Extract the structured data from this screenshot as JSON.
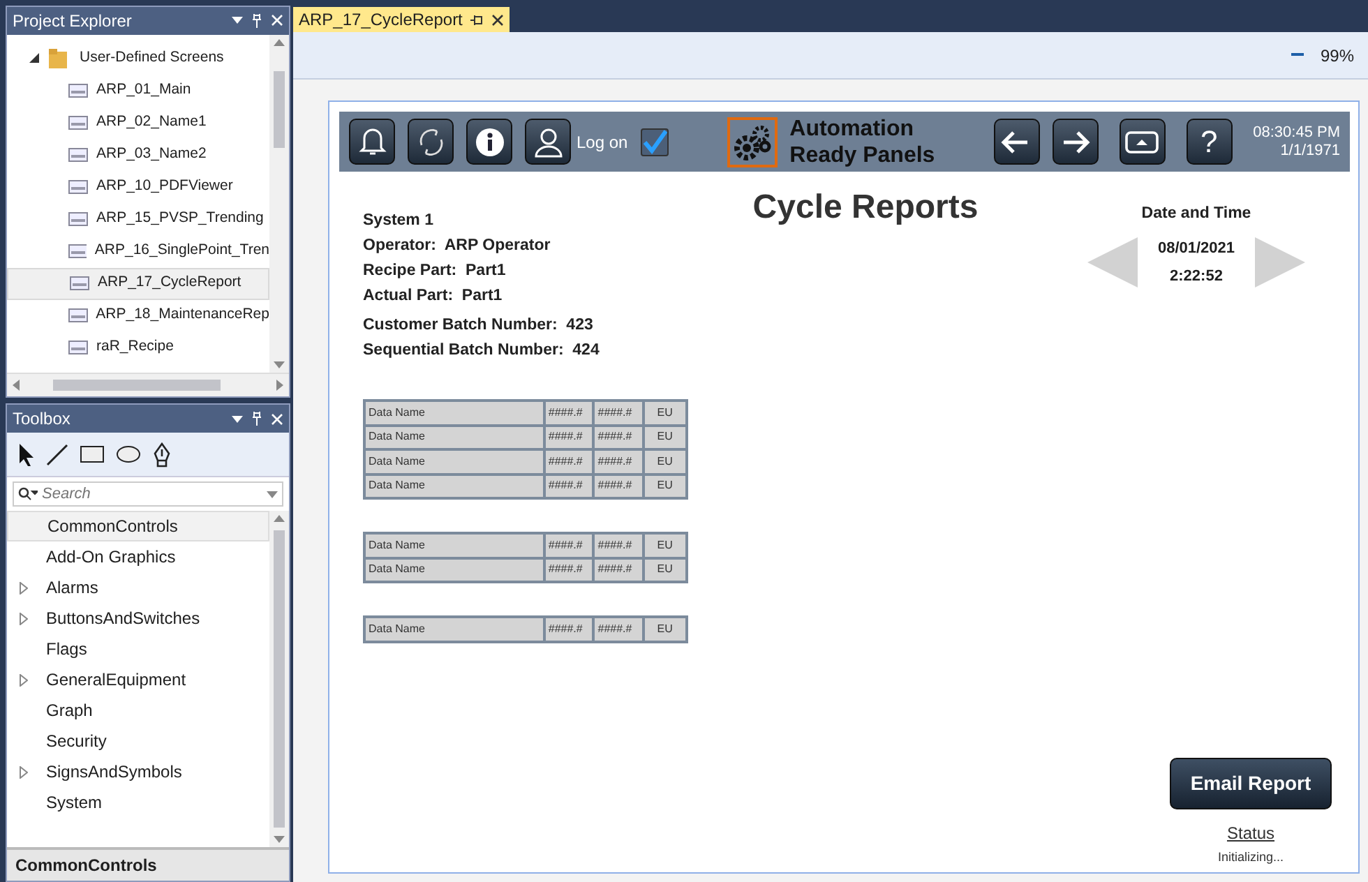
{
  "project_explorer": {
    "title": "Project Explorer",
    "folder": {
      "label": "User-Defined Screens",
      "expanded": true,
      "children": [
        {
          "label": "ARP_01_Main",
          "selected": false
        },
        {
          "label": "ARP_02_Name1",
          "selected": false
        },
        {
          "label": "ARP_03_Name2",
          "selected": false
        },
        {
          "label": "ARP_10_PDFViewer",
          "selected": false
        },
        {
          "label": "ARP_15_PVSP_Trending",
          "selected": false
        },
        {
          "label": "ARP_16_SinglePoint_Tren",
          "selected": false
        },
        {
          "label": "ARP_17_CycleReport",
          "selected": true
        },
        {
          "label": "ARP_18_MaintenanceRep",
          "selected": false
        },
        {
          "label": "raR_Recipe",
          "selected": false
        }
      ]
    }
  },
  "toolbox": {
    "title": "Toolbox",
    "search": {
      "placeholder": "Search"
    },
    "categories": [
      {
        "label": "CommonControls",
        "expandable": false,
        "selected": true
      },
      {
        "label": "Add-On Graphics",
        "expandable": false,
        "selected": false
      },
      {
        "label": "Alarms",
        "expandable": true,
        "selected": false
      },
      {
        "label": "ButtonsAndSwitches",
        "expandable": true,
        "selected": false
      },
      {
        "label": "Flags",
        "expandable": false,
        "selected": false
      },
      {
        "label": "GeneralEquipment",
        "expandable": true,
        "selected": false
      },
      {
        "label": "Graph",
        "expandable": false,
        "selected": false
      },
      {
        "label": "Security",
        "expandable": false,
        "selected": false
      },
      {
        "label": "SignsAndSymbols",
        "expandable": true,
        "selected": false
      },
      {
        "label": "System",
        "expandable": false,
        "selected": false
      }
    ],
    "footer": "CommonControls"
  },
  "document_tab": {
    "label": "ARP_17_CycleReport"
  },
  "zoom": "99%",
  "hmi": {
    "header": {
      "logon_label": "Log on",
      "logon_checked": true,
      "brand_lines": [
        "Automation",
        "Ready Panels"
      ],
      "help": "?",
      "time": "08:30:45 PM",
      "date": "1/1/1971"
    },
    "title": "Cycle Reports",
    "info": [
      "System 1",
      "Operator:  ARP Operator",
      "Recipe Part:  Part1",
      "Actual Part:  Part1",
      "Customer Batch Number:  423",
      "Sequential Batch Number:  424"
    ],
    "date_time": {
      "label": "Date and Time",
      "date": "08/01/2021",
      "time": "2:22:52"
    },
    "tables": [
      [
        {
          "name": "Data Name",
          "value_1": "####.#",
          "value_2": "####.#",
          "unit": "EU"
        },
        {
          "name": "Data Name",
          "value_1": "####.#",
          "value_2": "####.#",
          "unit": "EU"
        },
        {
          "name": "Data Name",
          "value_1": "####.#",
          "value_2": "####.#",
          "unit": "EU"
        },
        {
          "name": "Data Name",
          "value_1": "####.#",
          "value_2": "####.#",
          "unit": "EU"
        }
      ],
      [
        {
          "name": "Data Name",
          "value_1": "####.#",
          "value_2": "####.#",
          "unit": "EU"
        },
        {
          "name": "Data Name",
          "value_1": "####.#",
          "value_2": "####.#",
          "unit": "EU"
        }
      ],
      [
        {
          "name": "Data Name",
          "value_1": "####.#",
          "value_2": "####.#",
          "unit": "EU"
        }
      ]
    ],
    "email_button": "Email Report",
    "status_link": "Status",
    "status_text": "Initializing..."
  }
}
